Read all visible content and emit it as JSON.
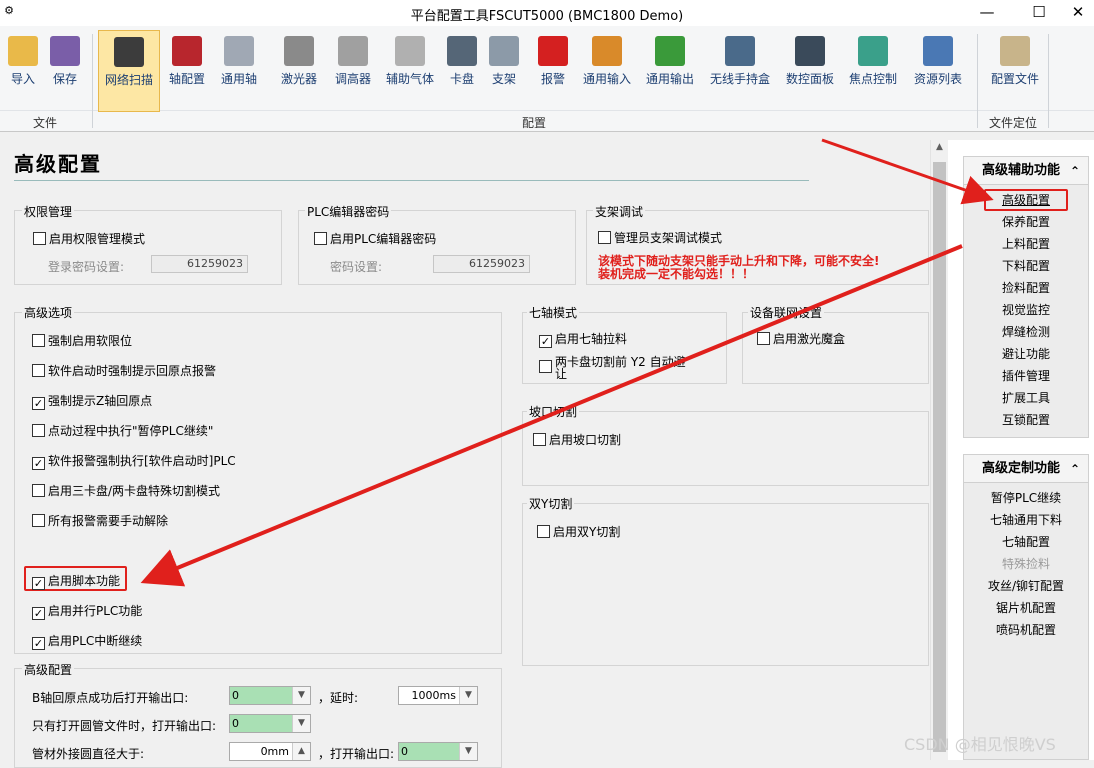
{
  "window": {
    "title": "平台配置工具FSCUT5000 (BMC1800 Demo)",
    "minimize": "—",
    "maximize": "☐",
    "close": "✕"
  },
  "ribbon": {
    "buttons": [
      {
        "label": "导入",
        "icon": "folder-icon",
        "color": "#e9b949"
      },
      {
        "label": "保存",
        "icon": "save-icon",
        "color": "#7a5ea8"
      },
      {
        "label": "网络扫描",
        "icon": "network-scan-icon",
        "color": "#3c3c3c"
      },
      {
        "label": "轴配置",
        "icon": "axis-motor-icon",
        "color": "#b8262d"
      },
      {
        "label": "通用轴",
        "icon": "general-axis-icon",
        "color": "#a0a8b4"
      },
      {
        "label": "激光器",
        "icon": "laser-icon",
        "color": "#8a8a8a"
      },
      {
        "label": "调高器",
        "icon": "height-controller-icon",
        "color": "#a0a0a0"
      },
      {
        "label": "辅助气体",
        "icon": "gauge-icon",
        "color": "#b0b0b0"
      },
      {
        "label": "卡盘",
        "icon": "chuck-icon",
        "color": "#556677"
      },
      {
        "label": "支架",
        "icon": "support-icon",
        "color": "#8c9aa8"
      },
      {
        "label": "报警",
        "icon": "alarm-light-icon",
        "color": "#d42020"
      },
      {
        "label": "通用输入",
        "icon": "input-icon",
        "color": "#d98a2a"
      },
      {
        "label": "通用输出",
        "icon": "output-icon",
        "color": "#3a9a3a"
      },
      {
        "label": "无线手持盒",
        "icon": "handheld-icon",
        "color": "#4a6a8a"
      },
      {
        "label": "数控面板",
        "icon": "panel-icon",
        "color": "#3a4a5a"
      },
      {
        "label": "焦点控制",
        "icon": "focus-icon",
        "color": "#3aa08a"
      },
      {
        "label": "资源列表",
        "icon": "list-icon",
        "color": "#4a78b4"
      },
      {
        "label": "配置文件",
        "icon": "config-file-icon",
        "color": "#c8b48a"
      }
    ],
    "groups": {
      "file": "文件",
      "config": "配置",
      "locate": "文件定位"
    }
  },
  "page": {
    "title": "高级配置"
  },
  "perm": {
    "title": "权限管理",
    "enable": "启用权限管理模式",
    "pwd_label": "登录密码设置:",
    "pwd_value": "61259023"
  },
  "plc_pwd": {
    "title": "PLC编辑器密码",
    "enable": "启用PLC编辑器密码",
    "pwd_label": "密码设置:",
    "pwd_value": "61259023"
  },
  "support": {
    "title": "支架调试",
    "enable": "管理员支架调试模式",
    "warning1": "该模式下随动支架只能手动上升和下降，可能不安全!",
    "warning2": "装机完成一定不能勾选！！！"
  },
  "adv_options": {
    "title": "高级选项",
    "items": [
      {
        "label": "强制启用软限位",
        "checked": false
      },
      {
        "label": "软件启动时强制提示回原点报警",
        "checked": false
      },
      {
        "label": "强制提示Z轴回原点",
        "checked": true
      },
      {
        "label": "点动过程中执行\"暂停PLC继续\"",
        "checked": false
      },
      {
        "label": "软件报警强制执行[软件启动时]PLC",
        "checked": true
      },
      {
        "label": "启用三卡盘/两卡盘特殊切割模式",
        "checked": false
      },
      {
        "label": "所有报警需要手动解除",
        "checked": false
      },
      {
        "label": "启用脚本功能",
        "checked": true
      },
      {
        "label": "启用并行PLC功能",
        "checked": true
      },
      {
        "label": "启用PLC中断继续",
        "checked": true
      }
    ]
  },
  "seventh_axis": {
    "title": "七轴模式",
    "items": [
      {
        "label": "启用七轴拉料",
        "checked": true
      },
      {
        "label": "两卡盘切割前 Y2 自动避让",
        "checked": false
      }
    ]
  },
  "network": {
    "title": "设备联网设置",
    "items": [
      {
        "label": "启用激光魔盒",
        "checked": false
      }
    ]
  },
  "bevel": {
    "title": "坡口切割",
    "items": [
      {
        "label": "启用坡口切割",
        "checked": false
      }
    ]
  },
  "dual_y": {
    "title": "双Y切割",
    "items": [
      {
        "label": "启用双Y切割",
        "checked": false
      }
    ]
  },
  "adv_config": {
    "title": "高级配置",
    "rows": [
      {
        "label": "B轴回原点成功后打开输出口:",
        "value": "0",
        "delay_label": "延时:",
        "delay_value": "1000ms"
      },
      {
        "label": "只有打开圆管文件时，打开输出口:",
        "value": "0"
      },
      {
        "label": "管材外接圆直径大于:",
        "value": "0mm",
        "out_label": "打开输出口:",
        "out_value": "0"
      }
    ]
  },
  "right_panel": {
    "aux": {
      "title": "高级辅助功能",
      "items": [
        "高级配置",
        "保养配置",
        "上料配置",
        "下料配置",
        "捡料配置",
        "视觉监控",
        "焊缝检测",
        "避让功能",
        "插件管理",
        "扩展工具",
        "互锁配置"
      ],
      "selected": 0
    },
    "custom": {
      "title": "高级定制功能",
      "items": [
        "暂停PLC继续",
        "七轴通用下料",
        "七轴配置",
        "特殊捡料",
        "攻丝/铆钉配置",
        "锯片机配置",
        "喷码机配置"
      ],
      "disabled": 3
    }
  },
  "watermark": "CSDN @相见恨晚VS"
}
